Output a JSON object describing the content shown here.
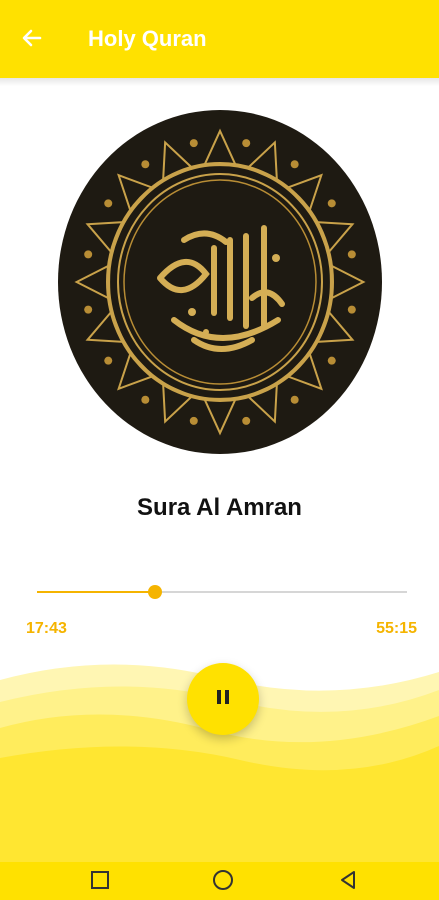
{
  "appbar": {
    "title": "Holy Quran",
    "back_icon": "arrow-left-icon"
  },
  "player": {
    "track_title": "Sura Al Amran",
    "elapsed": "17:43",
    "total": "55:15",
    "progress_fraction": 0.32,
    "state_icon": "pause-icon"
  },
  "navbar": {
    "icons": [
      "square-recents-icon",
      "circle-home-icon",
      "triangle-back-icon"
    ]
  },
  "colors": {
    "accent": "#FFE100",
    "progress": "#F5B400",
    "art_background": "#1E1A12",
    "art_gold": "#C9A24A"
  }
}
